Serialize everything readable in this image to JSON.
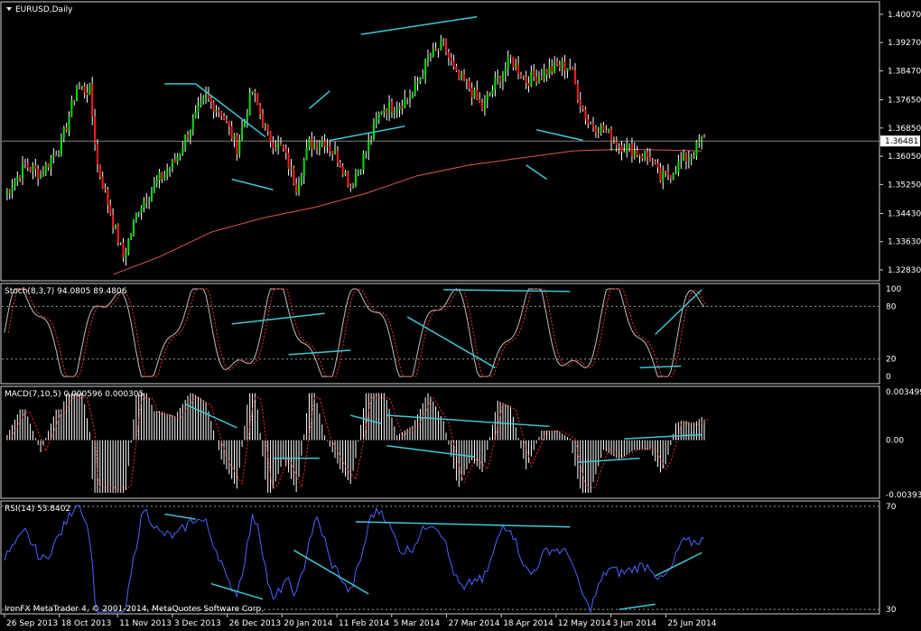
{
  "colors": {
    "background": "#000000",
    "frame": "#cfcfcf",
    "bull": "#00e000",
    "bear": "#ff1a1a",
    "wick": "#ffffff",
    "ma": "#e0584b",
    "trend": "#3fc7d6",
    "stoch_main": "#bfbfbf",
    "stoch_signal": "#ff2a2a",
    "macd_hist": "#ffffff",
    "macd_signal": "#ff2a2a",
    "rsi": "#4f63ff",
    "level": "#9a9a9a"
  },
  "watermark": "IronFX MetaTrader 4, © 2001-2014, MetaQuotes Software Corp.",
  "chart_data": [
    {
      "type": "candlestick",
      "title": "EURUSD,Daily",
      "y_ticks": [
        "1.40070",
        "1.39270",
        "1.38470",
        "1.37650",
        "1.36850",
        "1.36050",
        "1.35250",
        "1.34430",
        "1.33630",
        "1.32830"
      ],
      "ylim": [
        1.326,
        1.4022
      ],
      "current_price_label": "1.36481",
      "current_price": 1.36481,
      "anchors": [
        {
          "x": 0,
          "v": 1.3495
        },
        {
          "x": 8,
          "v": 1.358
        },
        {
          "x": 14,
          "v": 1.3555
        },
        {
          "x": 22,
          "v": 1.364
        },
        {
          "x": 28,
          "v": 1.38
        },
        {
          "x": 33,
          "v": 1.379
        },
        {
          "x": 36,
          "v": 1.358
        },
        {
          "x": 42,
          "v": 1.342
        },
        {
          "x": 46,
          "v": 1.332
        },
        {
          "x": 52,
          "v": 1.346
        },
        {
          "x": 60,
          "v": 1.354
        },
        {
          "x": 66,
          "v": 1.359
        },
        {
          "x": 72,
          "v": 1.369
        },
        {
          "x": 78,
          "v": 1.377
        },
        {
          "x": 84,
          "v": 1.373
        },
        {
          "x": 90,
          "v": 1.363
        },
        {
          "x": 96,
          "v": 1.379
        },
        {
          "x": 102,
          "v": 1.366
        },
        {
          "x": 108,
          "v": 1.362
        },
        {
          "x": 113,
          "v": 1.352
        },
        {
          "x": 118,
          "v": 1.364
        },
        {
          "x": 124,
          "v": 1.365
        },
        {
          "x": 130,
          "v": 1.359
        },
        {
          "x": 134,
          "v": 1.352
        },
        {
          "x": 140,
          "v": 1.362
        },
        {
          "x": 146,
          "v": 1.374
        },
        {
          "x": 152,
          "v": 1.375
        },
        {
          "x": 158,
          "v": 1.378
        },
        {
          "x": 164,
          "v": 1.388
        },
        {
          "x": 170,
          "v": 1.392
        },
        {
          "x": 175,
          "v": 1.383
        },
        {
          "x": 180,
          "v": 1.38
        },
        {
          "x": 185,
          "v": 1.374
        },
        {
          "x": 190,
          "v": 1.381
        },
        {
          "x": 196,
          "v": 1.388
        },
        {
          "x": 202,
          "v": 1.382
        },
        {
          "x": 208,
          "v": 1.384
        },
        {
          "x": 214,
          "v": 1.386
        },
        {
          "x": 219,
          "v": 1.386
        },
        {
          "x": 222,
          "v": 1.378
        },
        {
          "x": 226,
          "v": 1.37
        },
        {
          "x": 232,
          "v": 1.368
        },
        {
          "x": 238,
          "v": 1.364
        },
        {
          "x": 244,
          "v": 1.362
        },
        {
          "x": 250,
          "v": 1.36
        },
        {
          "x": 254,
          "v": 1.354
        },
        {
          "x": 258,
          "v": 1.356
        },
        {
          "x": 262,
          "v": 1.359
        },
        {
          "x": 266,
          "v": 1.361
        },
        {
          "x": 270,
          "v": 1.3648
        }
      ],
      "x_labels": [
        {
          "text": "26 Sep 2013",
          "bar": 0
        },
        {
          "text": "18 Oct 2013",
          "bar": 16
        },
        {
          "text": "11 Nov 2013",
          "bar": 33
        },
        {
          "text": "3 Dec 2013",
          "bar": 49
        },
        {
          "text": "26 Dec 2013",
          "bar": 65
        },
        {
          "text": "20 Jan 2014",
          "bar": 81
        },
        {
          "text": "11 Feb 2014",
          "bar": 97
        },
        {
          "text": "5 Mar 2014",
          "bar": 113
        },
        {
          "text": "27 Mar 2014",
          "bar": 129
        },
        {
          "text": "18 Apr 2014",
          "bar": 145
        },
        {
          "text": "12 May 2014",
          "bar": 161
        },
        {
          "text": "3 Jun 2014",
          "bar": 177
        },
        {
          "text": "25 Jun 2014",
          "bar": 193
        }
      ],
      "ma_points": [
        {
          "x": 42,
          "v": 1.327
        },
        {
          "x": 60,
          "v": 1.332
        },
        {
          "x": 80,
          "v": 1.339
        },
        {
          "x": 100,
          "v": 1.343
        },
        {
          "x": 120,
          "v": 1.346
        },
        {
          "x": 140,
          "v": 1.35
        },
        {
          "x": 160,
          "v": 1.355
        },
        {
          "x": 180,
          "v": 1.358
        },
        {
          "x": 200,
          "v": 1.36
        },
        {
          "x": 220,
          "v": 1.362
        },
        {
          "x": 240,
          "v": 1.3625
        },
        {
          "x": 270,
          "v": 1.362
        }
      ]
    },
    {
      "type": "line",
      "title": "Stoch(8,3,7) 94.0805 89.4806",
      "y_ticks": [
        "100",
        "80",
        "20",
        "0"
      ],
      "levels": [
        80,
        20
      ],
      "ylim": [
        -5,
        102
      ]
    },
    {
      "type": "histogram",
      "title": "MACD(7,10,5) 0.000596 0.000305",
      "y_ticks": [
        "0.003499",
        "0.00",
        "-0.003937"
      ],
      "ylim": [
        -0.003937,
        0.003499
      ]
    },
    {
      "type": "line",
      "title": "RSI(14) 53.8402",
      "y_ticks": [
        "70",
        "30"
      ],
      "levels": [
        70,
        30
      ],
      "ylim": [
        29,
        71
      ]
    }
  ]
}
